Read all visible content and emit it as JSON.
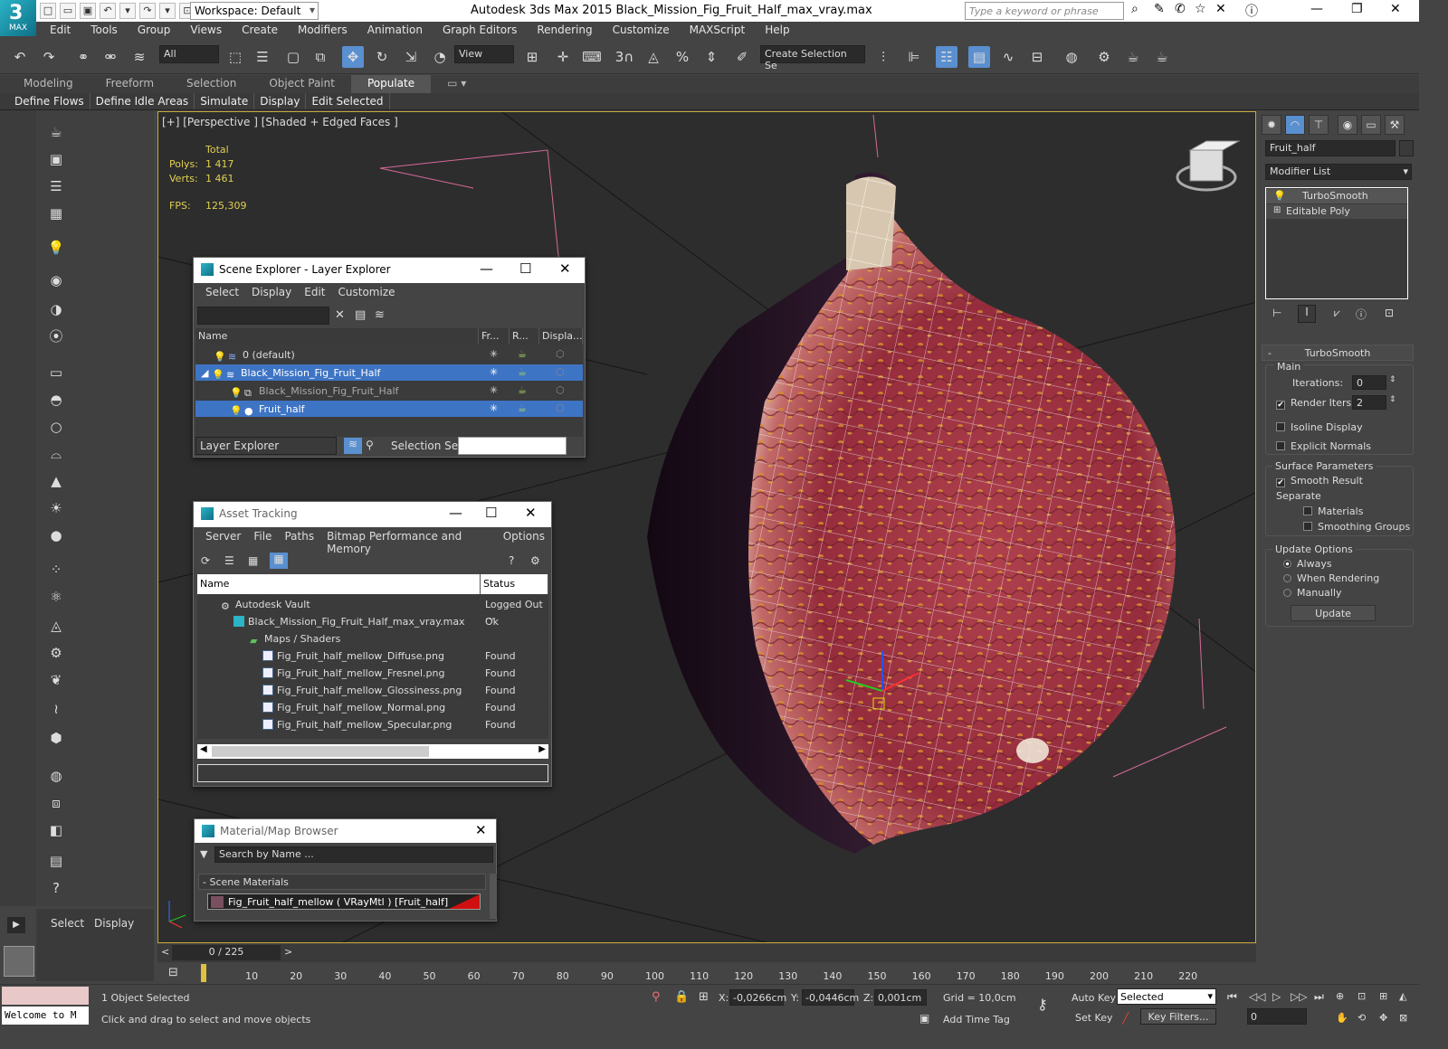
{
  "app": {
    "title": "Autodesk 3ds Max  2015     Black_Mission_Fig_Fruit_Half_max_vray.max",
    "logo_text": "MAX",
    "workspace": "Workspace: Default",
    "search_placeholder": "Type a keyword or phrase"
  },
  "menu": [
    "Edit",
    "Tools",
    "Group",
    "Views",
    "Create",
    "Modifiers",
    "Animation",
    "Graph Editors",
    "Rendering",
    "Customize",
    "MAXScript",
    "Help"
  ],
  "toolbar": {
    "filter": "All",
    "ref_coord": "View",
    "selection_set": "Create Selection Se"
  },
  "ribbon": {
    "tabs": [
      "Modeling",
      "Freeform",
      "Selection",
      "Object Paint",
      "Populate"
    ],
    "active": "Populate",
    "sub": [
      "Define Flows",
      "Define Idle Areas",
      "Simulate",
      "Display",
      "Edit Selected"
    ]
  },
  "viewport": {
    "label": "[+] [Perspective ] [Shaded + Edged Faces ]",
    "stats_header": "Total",
    "polys_label": "Polys:",
    "polys": "1 417",
    "verts_label": "Verts:",
    "verts": "1 461",
    "fps_label": "FPS:",
    "fps": "125,309"
  },
  "scene_explorer": {
    "title": "Scene Explorer - Layer Explorer",
    "menu": [
      "Select",
      "Display",
      "Edit",
      "Customize"
    ],
    "columns": [
      "Name",
      "Fr...",
      "R...",
      "Displa..."
    ],
    "rows": [
      {
        "name": "0 (default)",
        "indent": 0,
        "selected": false
      },
      {
        "name": "Black_Mission_Fig_Fruit_Half",
        "indent": 0,
        "selected": true
      },
      {
        "name": "Black_Mission_Fig_Fruit_Half",
        "indent": 1,
        "selected": false
      },
      {
        "name": "Fruit_half",
        "indent": 1,
        "selected": true
      }
    ],
    "footer_mode": "Layer Explorer",
    "selection_set_label": "Selection Set:"
  },
  "asset_tracking": {
    "title": "Asset Tracking",
    "menu": [
      "Server",
      "File",
      "Paths",
      "Bitmap Performance and Memory",
      "Options"
    ],
    "columns": [
      "Name",
      "Status"
    ],
    "rows": [
      {
        "name": "Autodesk Vault",
        "status": "Logged Out ...",
        "indent": 1
      },
      {
        "name": "Black_Mission_Fig_Fruit_Half_max_vray.max",
        "status": "Ok",
        "indent": 2
      },
      {
        "name": "Maps / Shaders",
        "status": "",
        "indent": 3
      },
      {
        "name": "Fig_Fruit_half_mellow_Diffuse.png",
        "status": "Found",
        "indent": 4
      },
      {
        "name": "Fig_Fruit_half_mellow_Fresnel.png",
        "status": "Found",
        "indent": 4
      },
      {
        "name": "Fig_Fruit_half_mellow_Glossiness.png",
        "status": "Found",
        "indent": 4
      },
      {
        "name": "Fig_Fruit_half_mellow_Normal.png",
        "status": "Found",
        "indent": 4
      },
      {
        "name": "Fig_Fruit_half_mellow_Specular.png",
        "status": "Found",
        "indent": 4
      }
    ]
  },
  "material_browser": {
    "title": "Material/Map Browser",
    "search_placeholder": "Search by Name ...",
    "group": "- Scene Materials",
    "item": "Fig_Fruit_half_mellow  ( VRayMtl )  [Fruit_half]"
  },
  "command_panel": {
    "object_name": "Fruit_half",
    "modifier_list": "Modifier List",
    "stack": [
      "TurboSmooth",
      "Editable Poly"
    ],
    "rollout_title": "TurboSmooth",
    "main_label": "Main",
    "iterations_label": "Iterations:",
    "iterations": "0",
    "render_iters_label": "Render Iters:",
    "render_iters": "2",
    "isoline": "Isoline Display",
    "explicit": "Explicit Normals",
    "surface_label": "Surface Parameters",
    "smooth_result": "Smooth Result",
    "separate_label": "Separate",
    "materials": "Materials",
    "smoothing_groups": "Smoothing Groups",
    "update_label": "Update Options",
    "always": "Always",
    "when_rendering": "When Rendering",
    "manually": "Manually",
    "update_button": "Update"
  },
  "left_panel": {
    "select": "Select",
    "display": "Display"
  },
  "timeline": {
    "frame": "0 / 225",
    "ticks": [
      "10",
      "20",
      "30",
      "40",
      "50",
      "60",
      "70",
      "80",
      "90",
      "100",
      "110",
      "120",
      "130",
      "140",
      "150",
      "160",
      "170",
      "180",
      "190",
      "200",
      "210",
      "220"
    ]
  },
  "status": {
    "maxscript": "Welcome to M",
    "selected": "1 Object Selected",
    "prompt": "Click and drag to select and move objects",
    "x_label": "X:",
    "x": "-0,0266cm",
    "y_label": "Y:",
    "y": "-0,0446cm",
    "z_label": "Z:",
    "z": "0,001cm",
    "grid": "Grid = 10,0cm",
    "auto_key": "Auto Key",
    "set_key": "Set Key",
    "key_mode": "Selected",
    "key_filters": "Key Filters...",
    "add_time_tag": "Add Time Tag",
    "frame_field": "0"
  },
  "colors": {
    "accent": "#3e74c4",
    "viewport_border": "#c8a63c",
    "stats": "#e0d050",
    "fig_skin": "#2b1830",
    "fig_flesh": "#a8384a"
  }
}
